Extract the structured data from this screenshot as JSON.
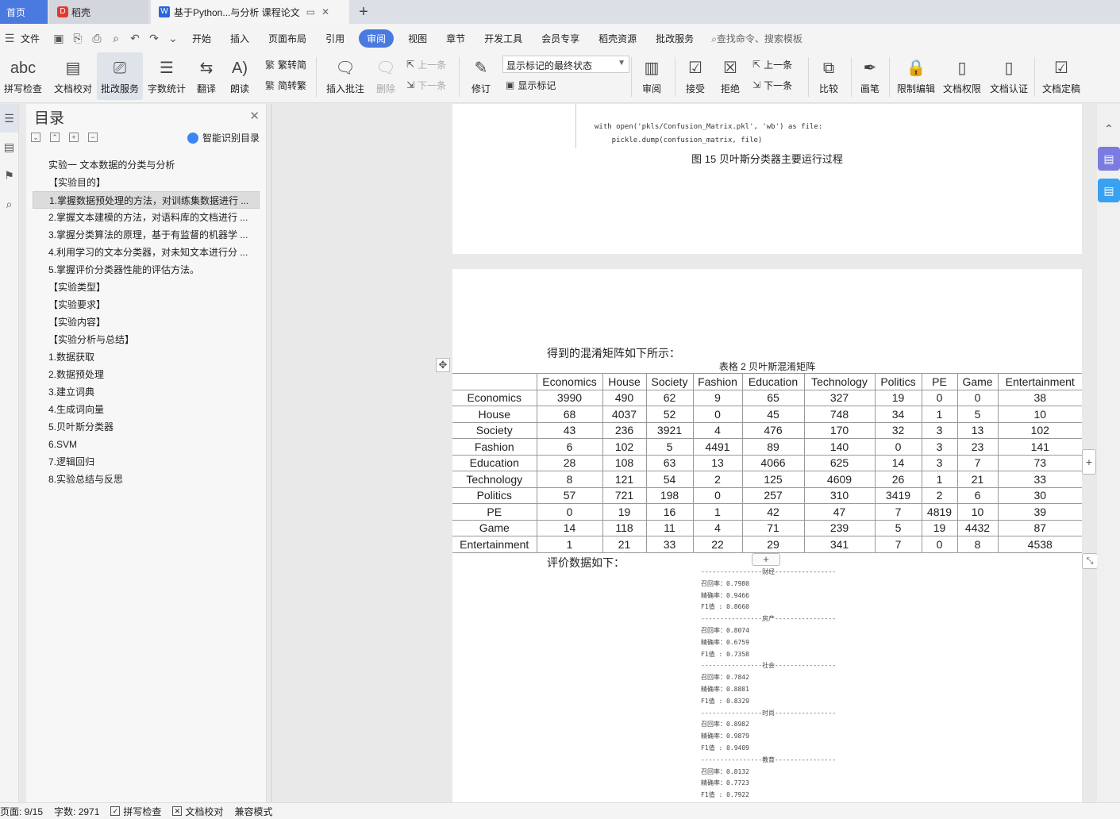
{
  "tabs": {
    "home": "首页",
    "daoke": "稻壳",
    "doc": "基于Python...与分析 课程论文"
  },
  "menu": [
    "文件",
    "开始",
    "插入",
    "页面布局",
    "引用",
    "审阅",
    "视图",
    "章节",
    "开发工具",
    "会员专享",
    "稻壳资源",
    "批改服务"
  ],
  "menu_active": "审阅",
  "search_placeholder": "查找命令、搜索模板",
  "ribbon": {
    "spell": "拼写检查",
    "doc_check": "文档校对",
    "correct_service": "批改服务",
    "word_count": "字数统计",
    "translate": "翻译",
    "read_aloud": "朗读",
    "trad": "繁转简",
    "simp": "简转繁",
    "insert_comment": "插入批注",
    "delete": "删除",
    "prev_comment": "上一条",
    "next_comment": "下一条",
    "revise": "修订",
    "display_mode": "显示标记的最终状态",
    "show_markup": "显示标记",
    "review": "审阅",
    "accept": "接受",
    "reject": "拒绝",
    "prev_change": "上一条",
    "next_change": "下一条",
    "compare": "比较",
    "pen": "画笔",
    "restrict": "限制编辑",
    "permission": "文档权限",
    "certify": "文档认证",
    "finalize": "文档定稿"
  },
  "toc": {
    "title": "目录",
    "smart": "智能识别目录",
    "items": [
      "实验一 文本数据的分类与分析",
      "【实验目的】",
      "1.掌握数据预处理的方法，对训练集数据进行 ...",
      "2.掌握文本建模的方法，对语料库的文档进行 ...",
      "3.掌握分类算法的原理，基于有监督的机器学 ...",
      "4.利用学习的文本分类器，对未知文本进行分 ...",
      "5.掌握评价分类器性能的评估方法。",
      "【实验类型】",
      "【实验要求】",
      "【实验内容】",
      "【实验分析与总结】",
      "1.数据获取",
      "2.数据预处理",
      "3.建立词典",
      "4.生成词向量",
      "5.贝叶斯分类器",
      "6.SVM",
      "7.逻辑回归",
      "8.实验总结与反思"
    ]
  },
  "doc": {
    "code_line1": "with open('pkls/Confusion_Matrix.pkl', 'wb') as file:",
    "code_line2": "    pickle.dump(confusion_matrix, file)",
    "fig_caption": "图 15 贝叶斯分类器主要运行过程",
    "intro_matrix": "得到的混淆矩阵如下所示：",
    "table_caption": "表格 2 贝叶斯混淆矩阵",
    "intro_eval": "评价数据如下："
  },
  "chart_data": {
    "type": "table",
    "title": "表格 2 贝叶斯混淆矩阵",
    "columns": [
      "Economics",
      "House",
      "Society",
      "Fashion",
      "Education",
      "Technology",
      "Politics",
      "PE",
      "Game",
      "Entertainment"
    ],
    "rows": [
      {
        "label": "Economics",
        "values": [
          3990,
          490,
          62,
          9,
          65,
          327,
          19,
          0,
          0,
          38
        ]
      },
      {
        "label": "House",
        "values": [
          68,
          4037,
          52,
          0,
          45,
          748,
          34,
          1,
          5,
          10
        ]
      },
      {
        "label": "Society",
        "values": [
          43,
          236,
          3921,
          4,
          476,
          170,
          32,
          3,
          13,
          102
        ]
      },
      {
        "label": "Fashion",
        "values": [
          6,
          102,
          5,
          4491,
          89,
          140,
          0,
          3,
          23,
          141
        ]
      },
      {
        "label": "Education",
        "values": [
          28,
          108,
          63,
          13,
          4066,
          625,
          14,
          3,
          7,
          73
        ]
      },
      {
        "label": "Technology",
        "values": [
          8,
          121,
          54,
          2,
          125,
          4609,
          26,
          1,
          21,
          33
        ]
      },
      {
        "label": "Politics",
        "values": [
          57,
          721,
          198,
          0,
          257,
          310,
          3419,
          2,
          6,
          30
        ]
      },
      {
        "label": "PE",
        "values": [
          0,
          19,
          16,
          1,
          42,
          47,
          7,
          4819,
          10,
          39
        ]
      },
      {
        "label": "Game",
        "values": [
          14,
          118,
          11,
          4,
          71,
          239,
          5,
          19,
          4432,
          87
        ]
      },
      {
        "label": "Entertainment",
        "values": [
          1,
          21,
          33,
          22,
          29,
          341,
          7,
          0,
          8,
          4538
        ]
      }
    ]
  },
  "eval": [
    {
      "category": "财经",
      "recall": "0.7980",
      "precision": "0.9466",
      "f1": "0.8660"
    },
    {
      "category": "房产",
      "recall": "0.8074",
      "precision": "0.6759",
      "f1": "0.7358"
    },
    {
      "category": "社会",
      "recall": "0.7842",
      "precision": "0.8881",
      "f1": "0.8329"
    },
    {
      "category": "时尚",
      "recall": "0.8982",
      "precision": "0.9879",
      "f1": "0.9409"
    },
    {
      "category": "教育",
      "recall": "0.8132",
      "precision": "0.7723",
      "f1": "0.7922"
    }
  ],
  "eval_labels": {
    "recall": "召回率",
    "precision": "精确率",
    "f1": "F1值"
  },
  "status": {
    "page": "页面: 9/15",
    "words": "字数: 2971",
    "spell": "拼写检查",
    "check": "文档校对",
    "compat": "兼容模式"
  }
}
